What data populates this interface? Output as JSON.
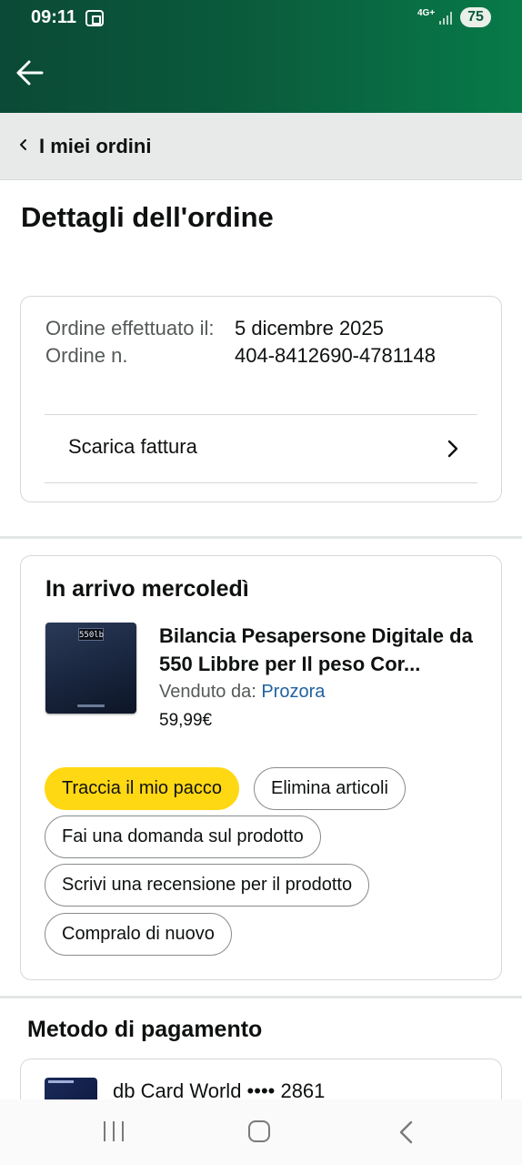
{
  "status_bar": {
    "time": "09:11",
    "network": "4G+",
    "battery": "75",
    "icons": [
      "screenshot-icon",
      "signal-icon"
    ]
  },
  "colors": {
    "header_gradient_start": "#0b4a36",
    "header_gradient_end": "#087a48",
    "primary_button": "#ffd814",
    "link": "#2162a1"
  },
  "breadcrumb": {
    "label": "I miei ordini"
  },
  "page": {
    "title": "Dettagli dell'ordine"
  },
  "order_info": {
    "label_placed": "Ordine effettuato il:",
    "label_number": "Ordine n.",
    "date": "5 dicembre 2025",
    "number": "404-8412690-4781148",
    "invoice_label": "Scarica fattura"
  },
  "shipment": {
    "title": "In arrivo mercoledì",
    "product": {
      "title": "Bilancia Pesapersone Digitale da 550 Libbre per Il peso Cor...",
      "seller_label": "Venduto da:",
      "seller_name": "Prozora",
      "price": "59,99€",
      "display_text": "550lb"
    },
    "buttons": {
      "track": "Traccia il mio pacco",
      "delete": "Elimina articoli",
      "ask": "Fai una domanda sul prodotto",
      "review": "Scrivi una recensione per il prodotto",
      "buy_again": "Compralo di nuovo"
    }
  },
  "payment": {
    "title": "Metodo di pagamento",
    "card_name": "db Card World •••• 2861"
  },
  "nav_bar": {
    "icons": [
      "recent-apps-icon",
      "home-icon",
      "back-icon"
    ]
  }
}
